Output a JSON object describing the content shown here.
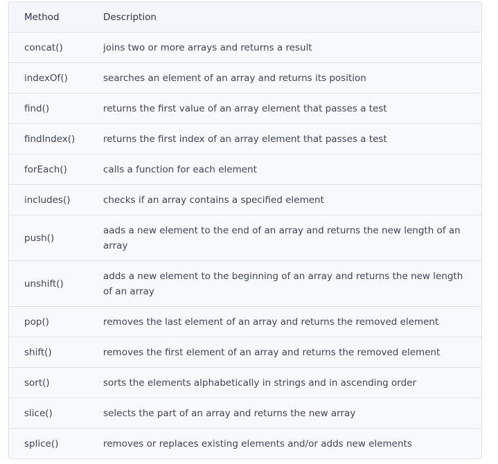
{
  "table": {
    "headers": [
      "Method",
      "Description"
    ],
    "rows": [
      [
        "concat()",
        "joins two or more arrays and returns a result"
      ],
      [
        "indexOf()",
        "searches an element of an array and returns its position"
      ],
      [
        "find()",
        "returns the first value of an array element that passes a test"
      ],
      [
        "findIndex()",
        "returns the first index of an array element that passes a test"
      ],
      [
        "forEach()",
        "calls a function for each element"
      ],
      [
        "includes()",
        "checks if an array contains a specified element"
      ],
      [
        "push()",
        "aads a new element to the end of an array and returns the new length of an array"
      ],
      [
        "unshift()",
        "adds a new element to the beginning of an array and returns the new length of an array"
      ],
      [
        "pop()",
        "removes the last element of an array and returns the removed element"
      ],
      [
        "shift()",
        "removes the first element of an array and returns the removed element"
      ],
      [
        "sort()",
        "sorts the elements alphabetically in strings and in ascending order"
      ],
      [
        "slice()",
        "selects the part of an array and returns the new array"
      ],
      [
        "splice()",
        "removes or replaces existing elements and/or adds new elements"
      ]
    ]
  }
}
